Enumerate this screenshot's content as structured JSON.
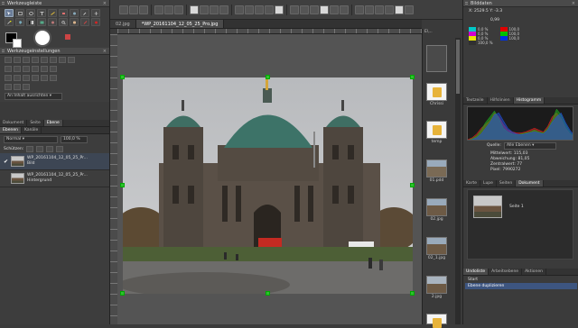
{
  "left_panel": {
    "tools_title": "Werkzeugleiste",
    "options_title": "Werkzeugeinstellungen",
    "fit_option": "An Inhalt ausrichten",
    "doc_tabs": [
      "Dokument",
      "Seite",
      "Ebene"
    ],
    "layer_tabs": [
      "Ebenen",
      "Kanäle"
    ],
    "blend_mode": "Normal",
    "opacity": "100,0 %",
    "protect_label": "Schützen:",
    "layers": [
      {
        "name": "WP_20161104_12_05_25_Pr...",
        "sub": "Bild"
      },
      {
        "name": "WP_20161104_12_05_25_Pr...",
        "sub": "Hintergrund"
      }
    ]
  },
  "doc_tabs": [
    "02.jpg",
    "*WP_20161104_12_05_25_Pro.jpg"
  ],
  "strip": {
    "path": "E\\...",
    "items": [
      "Chrissi",
      "temp",
      "01.pdd",
      "02.jpg",
      "02_1.jpg",
      "2.jpg"
    ]
  },
  "right_panel": {
    "title": "Bilddaten",
    "coords": "X: 2529.5 Y: -3.3",
    "size_val": "0,99",
    "channels": [
      {
        "label": "0,0 %",
        "color": "#00c8c8"
      },
      {
        "label": "0,0 %",
        "color": "#d000d0"
      },
      {
        "label": "0,0 %",
        "color": "#e6e600"
      },
      {
        "label": "100,0 %",
        "color": "#303030"
      }
    ],
    "channels_rgb": [
      {
        "label": "100,0",
        "color": "#e00000"
      },
      {
        "label": "100,0",
        "color": "#00c000"
      },
      {
        "label": "100,0",
        "color": "#0030e0"
      }
    ],
    "histo_tabs": [
      "Textzeile",
      "Hilfslinien",
      "Histogramm"
    ],
    "source_label": "Quelle:",
    "source_value": "Alle Ebenen",
    "stats": [
      "Mittelwert: 115,03",
      "Abweichung: 81,05",
      "Zentralwert: 77",
      "Pixel: 7990272"
    ],
    "nav_tabs": [
      "Karte",
      "Lupe",
      "Seiten",
      "Dokument"
    ],
    "page_label": "Seite 1",
    "undo_tabs": [
      "Undoliste",
      "Arbeitsebene",
      "Aktionen"
    ],
    "undo_items": [
      "Start",
      "Ebene duplizieren"
    ]
  },
  "chart_data": {
    "type": "area",
    "series": [
      {
        "values": [
          2,
          4,
          8,
          14,
          18,
          22,
          30,
          26,
          18,
          12,
          10,
          9,
          9,
          10,
          12,
          14,
          12,
          10,
          16,
          26,
          30,
          24,
          14,
          8,
          4
        ]
      },
      {
        "values": [
          1,
          3,
          6,
          12,
          20,
          26,
          32,
          24,
          14,
          10,
          8,
          7,
          8,
          9,
          10,
          12,
          10,
          9,
          14,
          22,
          34,
          28,
          18,
          10,
          5
        ]
      },
      {
        "values": [
          1,
          2,
          4,
          8,
          14,
          20,
          28,
          30,
          22,
          14,
          10,
          8,
          7,
          8,
          9,
          10,
          9,
          8,
          12,
          20,
          26,
          30,
          20,
          12,
          6
        ]
      }
    ],
    "colors": [
      "#e02020",
      "#20b020",
      "#2050e0"
    ]
  }
}
